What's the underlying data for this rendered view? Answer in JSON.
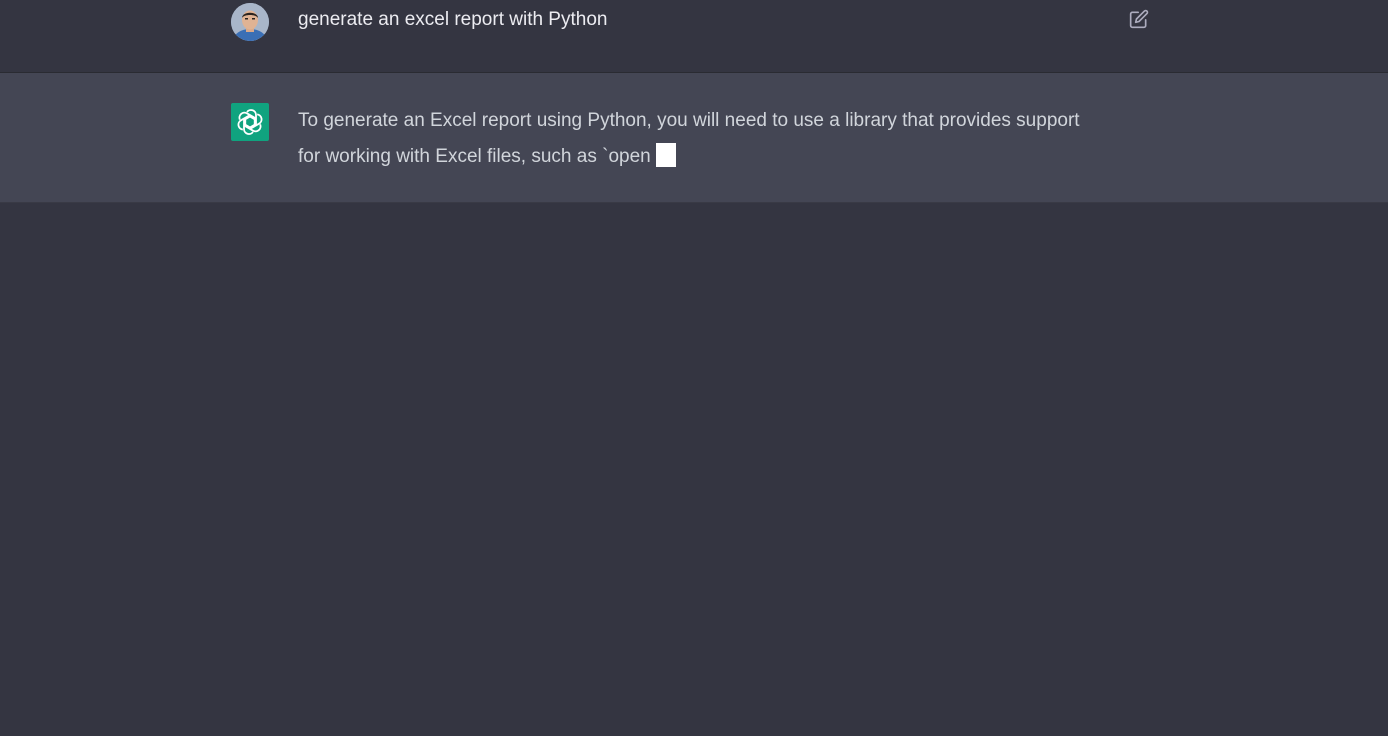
{
  "conversation": {
    "user_message": {
      "avatar_icon": "user-avatar-photo",
      "text": "generate an excel report with Python",
      "edit_icon": "edit-icon"
    },
    "assistant_message": {
      "avatar_icon": "openai-logo-icon",
      "text": "To generate an Excel report using Python, you will need to use a library that provides support for working with Excel files, such as `open",
      "streaming_cursor": true
    }
  },
  "colors": {
    "background": "#343541",
    "assistant_row": "#444654",
    "accent": "#10a37f",
    "text": "#ececf1"
  }
}
